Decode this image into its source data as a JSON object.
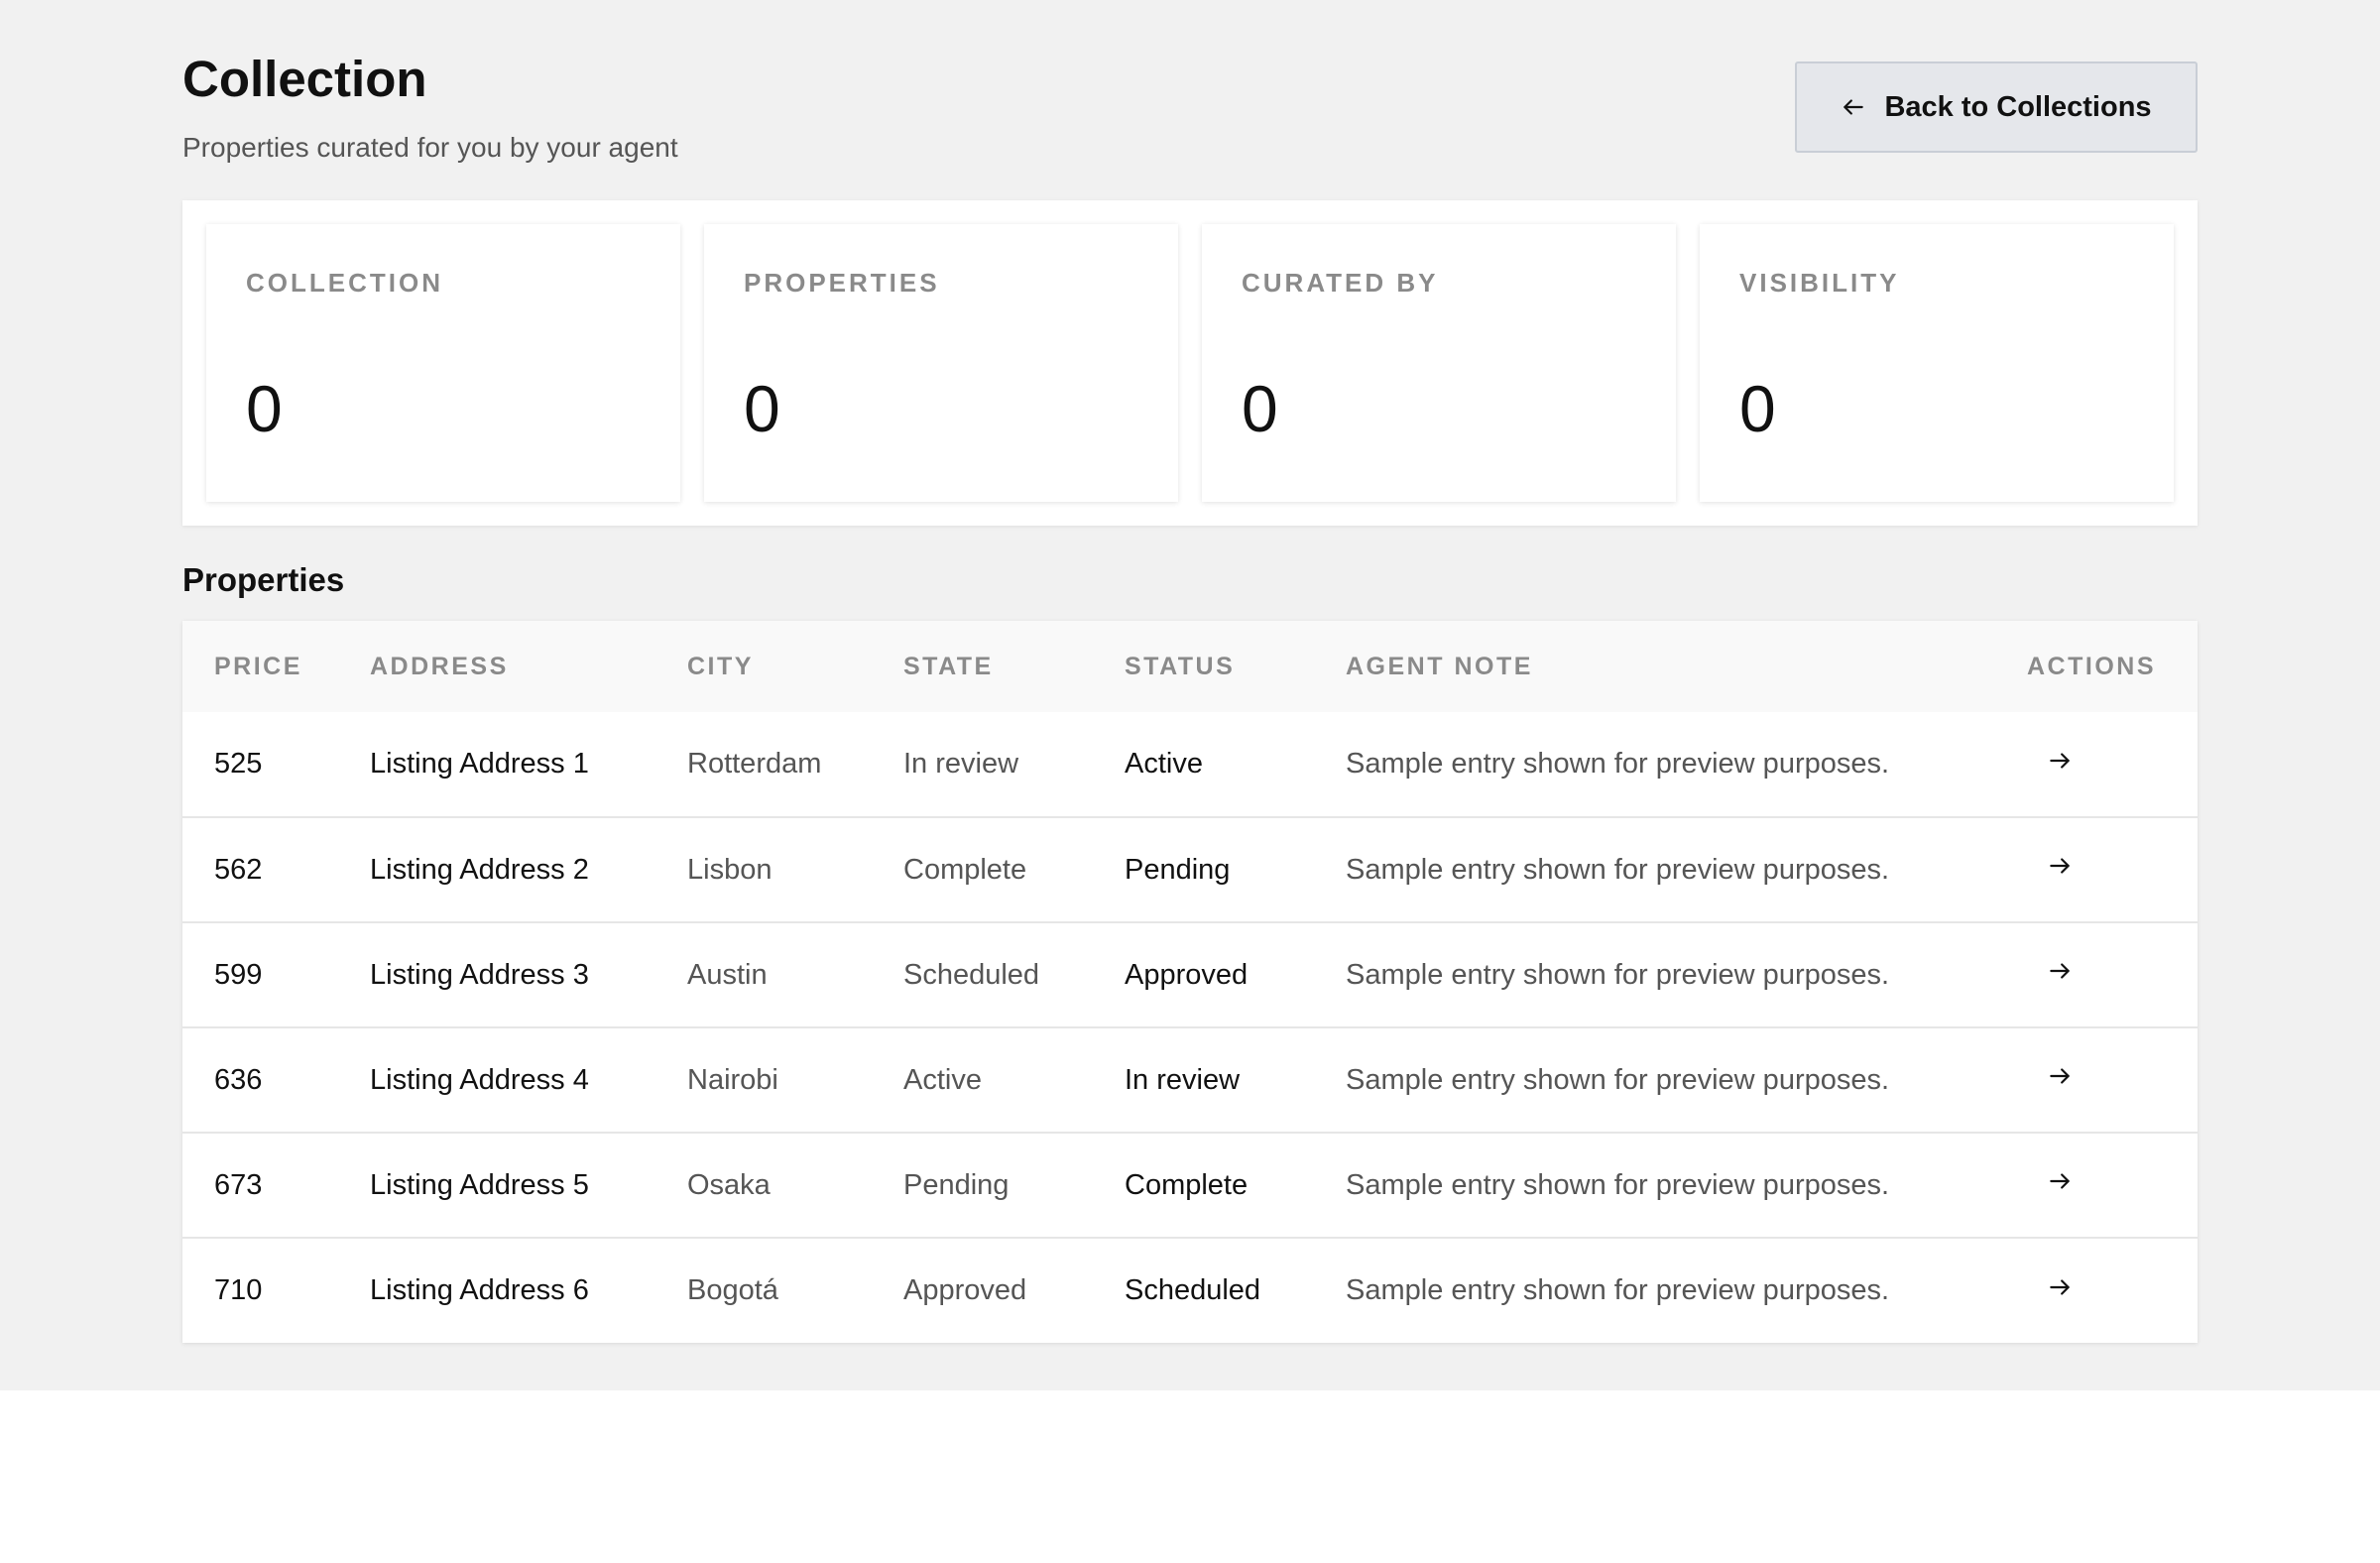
{
  "header": {
    "title": "Collection",
    "subtitle": "Properties curated for you by your agent",
    "back_button_label": "Back to Collections"
  },
  "stats": [
    {
      "label": "COLLECTION",
      "value": "0"
    },
    {
      "label": "PROPERTIES",
      "value": "0"
    },
    {
      "label": "CURATED BY",
      "value": "0"
    },
    {
      "label": "VISIBILITY",
      "value": "0"
    }
  ],
  "properties_section": {
    "title": "Properties",
    "columns": [
      "PRICE",
      "ADDRESS",
      "CITY",
      "STATE",
      "STATUS",
      "AGENT NOTE",
      "ACTIONS"
    ],
    "rows": [
      {
        "price": "525",
        "address": "Listing Address 1",
        "city": "Rotterdam",
        "state": "In review",
        "status": "Active",
        "note": "Sample entry shown for preview purposes."
      },
      {
        "price": "562",
        "address": "Listing Address 2",
        "city": "Lisbon",
        "state": "Complete",
        "status": "Pending",
        "note": "Sample entry shown for preview purposes."
      },
      {
        "price": "599",
        "address": "Listing Address 3",
        "city": "Austin",
        "state": "Scheduled",
        "status": "Approved",
        "note": "Sample entry shown for preview purposes."
      },
      {
        "price": "636",
        "address": "Listing Address 4",
        "city": "Nairobi",
        "state": "Active",
        "status": "In review",
        "note": "Sample entry shown for preview purposes."
      },
      {
        "price": "673",
        "address": "Listing Address 5",
        "city": "Osaka",
        "state": "Pending",
        "status": "Complete",
        "note": "Sample entry shown for preview purposes."
      },
      {
        "price": "710",
        "address": "Listing Address 6",
        "city": "Bogotá",
        "state": "Approved",
        "status": "Scheduled",
        "note": "Sample entry shown for preview purposes."
      }
    ]
  },
  "icons": {
    "back": "arrow-left-icon",
    "row_action": "arrow-right-icon"
  },
  "colors": {
    "page_background": "#f1f1f1",
    "button_background": "#e5e7eb",
    "muted_text": "#8a8a8a"
  }
}
